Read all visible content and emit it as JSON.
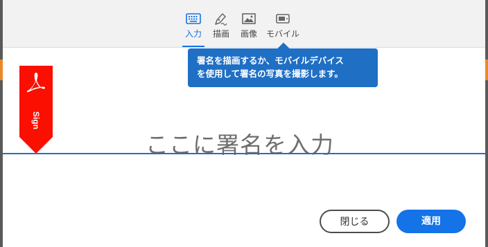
{
  "tabs": [
    {
      "label": "入力",
      "icon": "keyboard-icon",
      "active": true
    },
    {
      "label": "描画",
      "icon": "pen-icon",
      "active": false
    },
    {
      "label": "画像",
      "icon": "image-icon",
      "active": false
    },
    {
      "label": "モバイル",
      "icon": "mobile-icon",
      "active": false
    }
  ],
  "tooltip": {
    "line1": "署名を描画するか、モバイルデバイス",
    "line2": "を使用して署名の写真を撮影します。"
  },
  "ribbon": {
    "label": "Sign",
    "icon": "acrobat-logo-icon"
  },
  "signature": {
    "placeholder": "ここに署名を入力"
  },
  "buttons": {
    "close": "閉じる",
    "apply": "適用"
  },
  "colors": {
    "accent": "#1473e6",
    "tooltip_bg": "#1f6fc5",
    "ribbon_red": "#fa0f00",
    "underlay_orange": "#e8892a"
  }
}
